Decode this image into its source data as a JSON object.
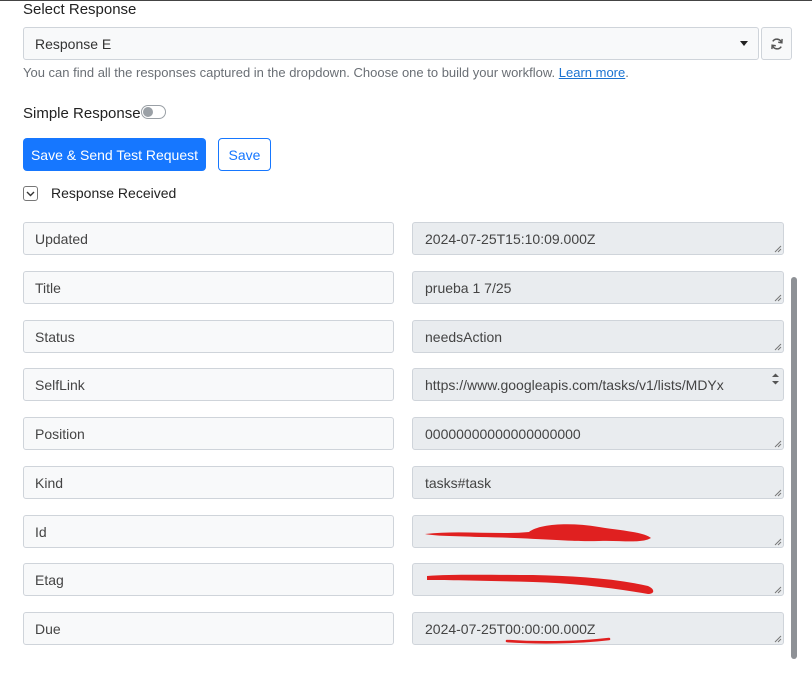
{
  "select": {
    "label": "Select Response",
    "value": "Response E",
    "helper_text": "You can find all the responses captured in the dropdown. Choose one to build your workflow.",
    "learn_more": "Learn more",
    "helper_end": "."
  },
  "simple_response": {
    "label": "Simple Response",
    "enabled": false
  },
  "buttons": {
    "save_send": "Save & Send Test Request",
    "save": "Save"
  },
  "response_section": {
    "label": "Response Received",
    "expanded": true
  },
  "fields": [
    {
      "key": "Updated",
      "value": "2024-07-25T15:10:09.000Z"
    },
    {
      "key": "Title",
      "value": "prueba 1 7/25"
    },
    {
      "key": "Status",
      "value": "needsAction"
    },
    {
      "key": "SelfLink",
      "value": "https://www.googleapis.com/tasks/v1/lists/MDYx"
    },
    {
      "key": "Position",
      "value": "00000000000000000000"
    },
    {
      "key": "Kind",
      "value": "tasks#task"
    },
    {
      "key": "Id",
      "value": ""
    },
    {
      "key": "Etag",
      "value": ""
    },
    {
      "key": "Due",
      "value": "2024-07-25T00:00:00.000Z"
    }
  ],
  "colors": {
    "primary": "#1677ff",
    "redaction": "#e02020",
    "link": "#1a73d1"
  }
}
